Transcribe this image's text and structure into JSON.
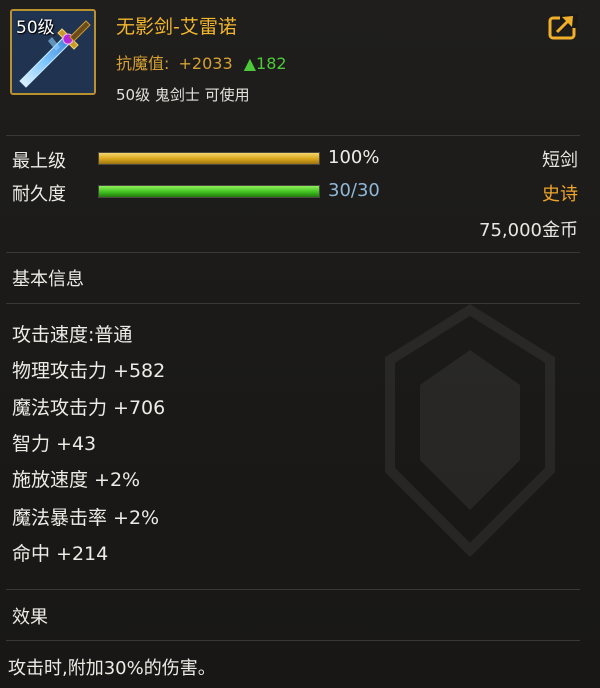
{
  "item": {
    "level_badge": "50级",
    "name": "无影剑-艾雷诺",
    "resist_label": "抗魔值:",
    "resist_value": "+2033",
    "resist_delta": "▲182",
    "requirement": "50级 鬼剑士 可使用"
  },
  "bars": [
    {
      "label": "最上级",
      "value_text": "100%",
      "fraction": 1.0,
      "style": "gold",
      "value_color": "#ecebe6"
    },
    {
      "label": "耐久度",
      "value_text": "30/30",
      "fraction": 1.0,
      "style": "green",
      "value_color": "#8fb7d8"
    }
  ],
  "right_info": {
    "weapon_type": "短剑",
    "rarity": "史诗",
    "rarity_color": "#f0a52a",
    "price": "75,000金币"
  },
  "sections": {
    "basic_title": "基本信息",
    "effect_title": "效果"
  },
  "stats": [
    "攻击速度:普通",
    "物理攻击力 +582",
    "魔法攻击力 +706",
    "智力 +43",
    "施放速度 +2%",
    "魔法暴击率 +2%",
    "命中 +214"
  ],
  "effect": "攻击时,附加30%的伤害。",
  "icons": {
    "item_icon": "sword-icon",
    "share": "share-icon"
  }
}
